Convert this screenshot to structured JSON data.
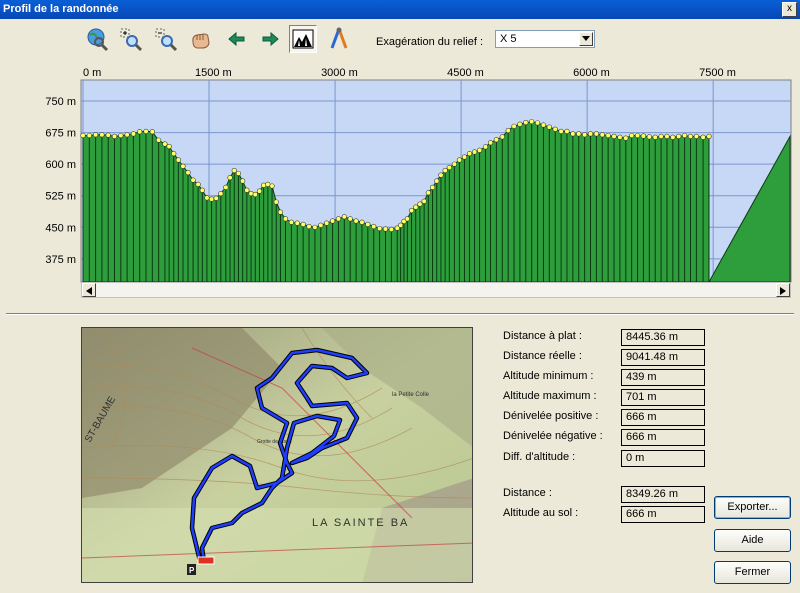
{
  "window": {
    "title": "Profil de la randonnée",
    "close_label": "x"
  },
  "toolbar": {
    "icons": [
      "globe-zoom-icon",
      "zoom-in-icon",
      "zoom-out-icon",
      "pan-hand-icon",
      "back-arrow-icon",
      "forward-arrow-icon",
      "terrain-profile-icon",
      "compass-measure-icon"
    ],
    "relief_label": "Exagération du relief :",
    "relief_value": "X 5"
  },
  "chart_data": {
    "type": "area",
    "x_unit": "m",
    "y_unit": "m",
    "x_ticks": [
      "0 m",
      "1500 m",
      "3000 m",
      "4500 m",
      "6000 m",
      "7500 m"
    ],
    "y_ticks": [
      "750 m",
      "675 m",
      "600 m",
      "525 m",
      "450 m",
      "375 m"
    ],
    "xlim": [
      0,
      7450
    ],
    "ylim": [
      320,
      800
    ],
    "grid": true,
    "fill_color": "#2e9d3c",
    "background_color": "#c6d8f6",
    "point_color": "#ffff66",
    "points": [
      [
        0,
        668
      ],
      [
        75,
        668
      ],
      [
        150,
        670
      ],
      [
        225,
        670
      ],
      [
        300,
        669
      ],
      [
        375,
        666
      ],
      [
        450,
        668
      ],
      [
        525,
        670
      ],
      [
        600,
        672
      ],
      [
        675,
        677
      ],
      [
        750,
        678
      ],
      [
        825,
        677
      ],
      [
        900,
        657
      ],
      [
        975,
        648
      ],
      [
        1025,
        642
      ],
      [
        1080,
        625
      ],
      [
        1135,
        610
      ],
      [
        1190,
        595
      ],
      [
        1250,
        580
      ],
      [
        1310,
        562
      ],
      [
        1370,
        552
      ],
      [
        1420,
        538
      ],
      [
        1475,
        520
      ],
      [
        1530,
        517
      ],
      [
        1585,
        519
      ],
      [
        1640,
        530
      ],
      [
        1700,
        545
      ],
      [
        1750,
        568
      ],
      [
        1800,
        585
      ],
      [
        1850,
        578
      ],
      [
        1900,
        560
      ],
      [
        1950,
        538
      ],
      [
        2000,
        530
      ],
      [
        2050,
        528
      ],
      [
        2100,
        536
      ],
      [
        2150,
        550
      ],
      [
        2200,
        552
      ],
      [
        2250,
        548
      ],
      [
        2300,
        510
      ],
      [
        2350,
        486
      ],
      [
        2410,
        470
      ],
      [
        2480,
        462
      ],
      [
        2550,
        460
      ],
      [
        2620,
        457
      ],
      [
        2690,
        452
      ],
      [
        2760,
        450
      ],
      [
        2830,
        455
      ],
      [
        2900,
        460
      ],
      [
        2970,
        465
      ],
      [
        3040,
        470
      ],
      [
        3110,
        475
      ],
      [
        3180,
        470
      ],
      [
        3250,
        465
      ],
      [
        3320,
        462
      ],
      [
        3390,
        457
      ],
      [
        3460,
        452
      ],
      [
        3530,
        447
      ],
      [
        3600,
        446
      ],
      [
        3670,
        445
      ],
      [
        3740,
        448
      ],
      [
        3780,
        455
      ],
      [
        3820,
        464
      ],
      [
        3860,
        470
      ],
      [
        3910,
        490
      ],
      [
        3960,
        498
      ],
      [
        4010,
        505
      ],
      [
        4060,
        512
      ],
      [
        4110,
        532
      ],
      [
        4160,
        545
      ],
      [
        4210,
        560
      ],
      [
        4260,
        574
      ],
      [
        4310,
        585
      ],
      [
        4360,
        592
      ],
      [
        4420,
        600
      ],
      [
        4480,
        610
      ],
      [
        4540,
        617
      ],
      [
        4600,
        625
      ],
      [
        4660,
        629
      ],
      [
        4720,
        633
      ],
      [
        4790,
        641
      ],
      [
        4850,
        651
      ],
      [
        4920,
        658
      ],
      [
        4990,
        665
      ],
      [
        5060,
        680
      ],
      [
        5130,
        690
      ],
      [
        5200,
        695
      ],
      [
        5270,
        699
      ],
      [
        5340,
        701
      ],
      [
        5410,
        698
      ],
      [
        5480,
        693
      ],
      [
        5550,
        688
      ],
      [
        5620,
        683
      ],
      [
        5690,
        678
      ],
      [
        5760,
        678
      ],
      [
        5830,
        672
      ],
      [
        5900,
        672
      ],
      [
        5970,
        670
      ],
      [
        6040,
        672
      ],
      [
        6110,
        672
      ],
      [
        6180,
        670
      ],
      [
        6250,
        668
      ],
      [
        6320,
        666
      ],
      [
        6390,
        664
      ],
      [
        6460,
        662
      ],
      [
        6530,
        668
      ],
      [
        6600,
        668
      ],
      [
        6670,
        667
      ],
      [
        6740,
        665
      ],
      [
        6810,
        664
      ],
      [
        6880,
        666
      ],
      [
        6950,
        666
      ],
      [
        7020,
        664
      ],
      [
        7090,
        666
      ],
      [
        7160,
        668
      ],
      [
        7230,
        666
      ],
      [
        7300,
        666
      ],
      [
        7380,
        664
      ],
      [
        7450,
        666
      ]
    ]
  },
  "stats": [
    {
      "label": "Distance à plat :",
      "value": "8445.36 m"
    },
    {
      "label": "Distance réelle :",
      "value": "9041.48 m"
    },
    {
      "label": "Altitude minimum :",
      "value": "439 m"
    },
    {
      "label": "Altitude maximum :",
      "value": "701 m"
    },
    {
      "label": "Dénivelée positive :",
      "value": "666 m"
    },
    {
      "label": "Dénivelée négative :",
      "value": "666 m"
    },
    {
      "label": "Diff. d'altitude :",
      "value": "0 m"
    }
  ],
  "cursor_stats": [
    {
      "label": "Distance :",
      "value": "8349.26 m"
    },
    {
      "label": "Altitude au sol :",
      "value": "666 m"
    }
  ],
  "buttons": {
    "export": "Exporter...",
    "help": "Aide",
    "close": "Fermer"
  },
  "map": {
    "labels": [
      "ST-BAUME",
      "LA SAINTE BA",
      "la Petite Colle",
      "Grotte de Marie"
    ],
    "route_color": "#1f3fff"
  }
}
